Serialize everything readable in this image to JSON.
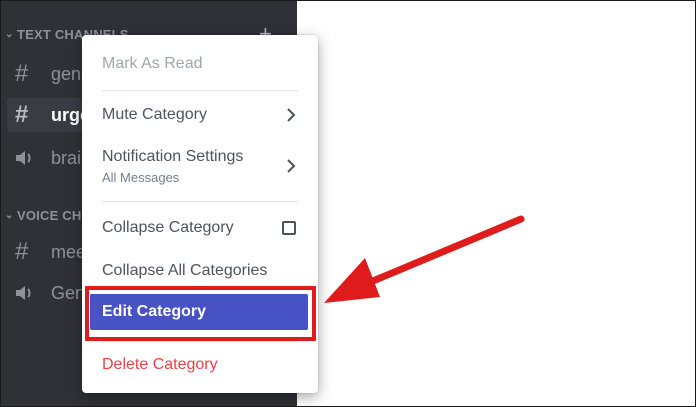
{
  "sidebar": {
    "categories": [
      {
        "label": "TEXT CHANNELS"
      },
      {
        "label": "VOICE CHANNELS"
      }
    ],
    "channels": [
      {
        "name": "general",
        "type": "text",
        "icon": "hash-icon"
      },
      {
        "name": "urgent",
        "type": "text",
        "icon": "hash-icon",
        "active": true
      },
      {
        "name": "brainstorm",
        "type": "voice",
        "icon": "speaker-icon"
      },
      {
        "name": "meeting",
        "type": "text",
        "icon": "hash-icon"
      },
      {
        "name": "General",
        "type": "voice",
        "icon": "speaker-icon"
      }
    ],
    "add_channel": "+"
  },
  "context_menu": {
    "mark_as_read": "Mark As Read",
    "mute_category": "Mute Category",
    "notification_settings": "Notification Settings",
    "notification_value": "All Messages",
    "collapse_category": "Collapse Category",
    "collapse_category_checked": false,
    "collapse_all": "Collapse All Categories",
    "edit_category": "Edit Category",
    "delete_category": "Delete Category"
  },
  "colors": {
    "sidebar_bg": "#2f3136",
    "active_channel_bg": "#393c43",
    "highlight_bg": "#4752c4",
    "danger": "#ed4245",
    "annotation_red": "#e01b1b"
  }
}
